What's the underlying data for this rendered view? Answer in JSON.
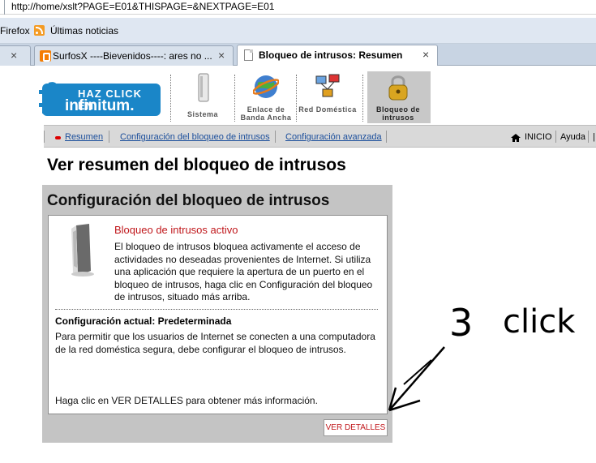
{
  "browser": {
    "url": "http://home/xslt?PAGE=E01&THISPAGE=&NEXTPAGE=E01",
    "bookmarks": {
      "firefox": "Firefox",
      "news": "Últimas noticias"
    },
    "tabs": [
      {
        "label": "",
        "close": "×"
      },
      {
        "label": "SurfosX ----Bievenidos----: ares no ...",
        "close": "×"
      },
      {
        "label": "Bloqueo de intrusos: Resumen",
        "close": "×"
      }
    ]
  },
  "header": {
    "logo": {
      "line1": "HAZ CLICK EN",
      "line2": "infinitum."
    },
    "nav": [
      {
        "label": "Sistema"
      },
      {
        "label": "Enlace de Banda Ancha"
      },
      {
        "label": "Red Doméstica"
      },
      {
        "label": "Bloqueo de intrusos"
      }
    ]
  },
  "subnav": {
    "items": [
      {
        "label": "Resumen"
      },
      {
        "label": "Configuración del bloqueo de intrusos"
      },
      {
        "label": "Configuración avanzada"
      }
    ],
    "right": {
      "home": "INICIO",
      "help": "Ayuda",
      "extra": "|"
    }
  },
  "page": {
    "title": "Ver resumen del bloqueo de intrusos",
    "panel": {
      "title": "Configuración del bloqueo de intrusos",
      "active_title": "Bloqueo de intrusos activo",
      "description": "El bloqueo de intrusos bloquea activamente el acceso de actividades no deseadas provenientes de Internet. Si utiliza una aplicación que requiere la apertura de un puerto en el bloqueo de intrusos, haga clic en Configuración del bloqueo de intrusos, situado más arriba.",
      "config_label": "Configuración actual: Predeterminada",
      "config_description": "Para permitir que los usuarios de Internet se conecten a una computadora de la red doméstica segura, debe configurar el bloqueo de intrusos.",
      "details_hint": "Haga clic en VER DETALLES para obtener más información.",
      "details_button": "VER DETALLES"
    }
  },
  "annotation": {
    "number": "3",
    "word": "click"
  },
  "colors": {
    "accent_red": "#c0171b",
    "link_blue": "#1b4e9b",
    "logo_blue": "#1a86c8"
  }
}
